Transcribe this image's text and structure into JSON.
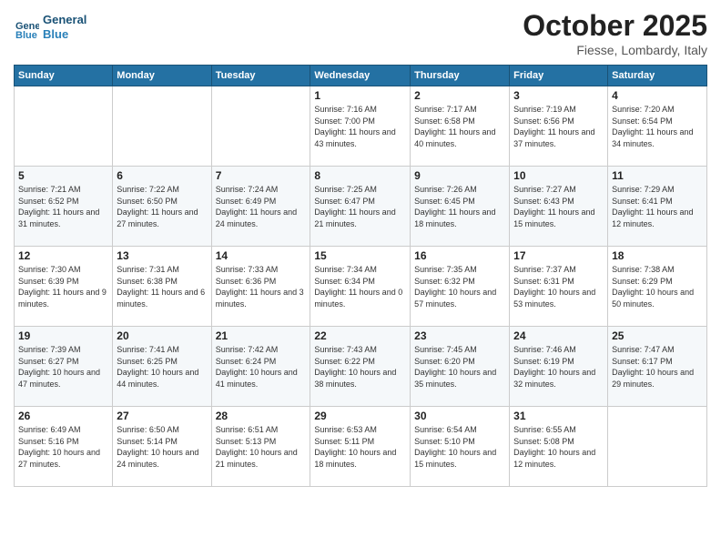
{
  "logo": {
    "line1": "General",
    "line2": "Blue"
  },
  "header": {
    "month": "October 2025",
    "location": "Fiesse, Lombardy, Italy"
  },
  "days_of_week": [
    "Sunday",
    "Monday",
    "Tuesday",
    "Wednesday",
    "Thursday",
    "Friday",
    "Saturday"
  ],
  "weeks": [
    [
      {
        "day": "",
        "sunrise": "",
        "sunset": "",
        "daylight": ""
      },
      {
        "day": "",
        "sunrise": "",
        "sunset": "",
        "daylight": ""
      },
      {
        "day": "",
        "sunrise": "",
        "sunset": "",
        "daylight": ""
      },
      {
        "day": "1",
        "sunrise": "Sunrise: 7:16 AM",
        "sunset": "Sunset: 7:00 PM",
        "daylight": "Daylight: 11 hours and 43 minutes."
      },
      {
        "day": "2",
        "sunrise": "Sunrise: 7:17 AM",
        "sunset": "Sunset: 6:58 PM",
        "daylight": "Daylight: 11 hours and 40 minutes."
      },
      {
        "day": "3",
        "sunrise": "Sunrise: 7:19 AM",
        "sunset": "Sunset: 6:56 PM",
        "daylight": "Daylight: 11 hours and 37 minutes."
      },
      {
        "day": "4",
        "sunrise": "Sunrise: 7:20 AM",
        "sunset": "Sunset: 6:54 PM",
        "daylight": "Daylight: 11 hours and 34 minutes."
      }
    ],
    [
      {
        "day": "5",
        "sunrise": "Sunrise: 7:21 AM",
        "sunset": "Sunset: 6:52 PM",
        "daylight": "Daylight: 11 hours and 31 minutes."
      },
      {
        "day": "6",
        "sunrise": "Sunrise: 7:22 AM",
        "sunset": "Sunset: 6:50 PM",
        "daylight": "Daylight: 11 hours and 27 minutes."
      },
      {
        "day": "7",
        "sunrise": "Sunrise: 7:24 AM",
        "sunset": "Sunset: 6:49 PM",
        "daylight": "Daylight: 11 hours and 24 minutes."
      },
      {
        "day": "8",
        "sunrise": "Sunrise: 7:25 AM",
        "sunset": "Sunset: 6:47 PM",
        "daylight": "Daylight: 11 hours and 21 minutes."
      },
      {
        "day": "9",
        "sunrise": "Sunrise: 7:26 AM",
        "sunset": "Sunset: 6:45 PM",
        "daylight": "Daylight: 11 hours and 18 minutes."
      },
      {
        "day": "10",
        "sunrise": "Sunrise: 7:27 AM",
        "sunset": "Sunset: 6:43 PM",
        "daylight": "Daylight: 11 hours and 15 minutes."
      },
      {
        "day": "11",
        "sunrise": "Sunrise: 7:29 AM",
        "sunset": "Sunset: 6:41 PM",
        "daylight": "Daylight: 11 hours and 12 minutes."
      }
    ],
    [
      {
        "day": "12",
        "sunrise": "Sunrise: 7:30 AM",
        "sunset": "Sunset: 6:39 PM",
        "daylight": "Daylight: 11 hours and 9 minutes."
      },
      {
        "day": "13",
        "sunrise": "Sunrise: 7:31 AM",
        "sunset": "Sunset: 6:38 PM",
        "daylight": "Daylight: 11 hours and 6 minutes."
      },
      {
        "day": "14",
        "sunrise": "Sunrise: 7:33 AM",
        "sunset": "Sunset: 6:36 PM",
        "daylight": "Daylight: 11 hours and 3 minutes."
      },
      {
        "day": "15",
        "sunrise": "Sunrise: 7:34 AM",
        "sunset": "Sunset: 6:34 PM",
        "daylight": "Daylight: 11 hours and 0 minutes."
      },
      {
        "day": "16",
        "sunrise": "Sunrise: 7:35 AM",
        "sunset": "Sunset: 6:32 PM",
        "daylight": "Daylight: 10 hours and 57 minutes."
      },
      {
        "day": "17",
        "sunrise": "Sunrise: 7:37 AM",
        "sunset": "Sunset: 6:31 PM",
        "daylight": "Daylight: 10 hours and 53 minutes."
      },
      {
        "day": "18",
        "sunrise": "Sunrise: 7:38 AM",
        "sunset": "Sunset: 6:29 PM",
        "daylight": "Daylight: 10 hours and 50 minutes."
      }
    ],
    [
      {
        "day": "19",
        "sunrise": "Sunrise: 7:39 AM",
        "sunset": "Sunset: 6:27 PM",
        "daylight": "Daylight: 10 hours and 47 minutes."
      },
      {
        "day": "20",
        "sunrise": "Sunrise: 7:41 AM",
        "sunset": "Sunset: 6:25 PM",
        "daylight": "Daylight: 10 hours and 44 minutes."
      },
      {
        "day": "21",
        "sunrise": "Sunrise: 7:42 AM",
        "sunset": "Sunset: 6:24 PM",
        "daylight": "Daylight: 10 hours and 41 minutes."
      },
      {
        "day": "22",
        "sunrise": "Sunrise: 7:43 AM",
        "sunset": "Sunset: 6:22 PM",
        "daylight": "Daylight: 10 hours and 38 minutes."
      },
      {
        "day": "23",
        "sunrise": "Sunrise: 7:45 AM",
        "sunset": "Sunset: 6:20 PM",
        "daylight": "Daylight: 10 hours and 35 minutes."
      },
      {
        "day": "24",
        "sunrise": "Sunrise: 7:46 AM",
        "sunset": "Sunset: 6:19 PM",
        "daylight": "Daylight: 10 hours and 32 minutes."
      },
      {
        "day": "25",
        "sunrise": "Sunrise: 7:47 AM",
        "sunset": "Sunset: 6:17 PM",
        "daylight": "Daylight: 10 hours and 29 minutes."
      }
    ],
    [
      {
        "day": "26",
        "sunrise": "Sunrise: 6:49 AM",
        "sunset": "Sunset: 5:16 PM",
        "daylight": "Daylight: 10 hours and 27 minutes."
      },
      {
        "day": "27",
        "sunrise": "Sunrise: 6:50 AM",
        "sunset": "Sunset: 5:14 PM",
        "daylight": "Daylight: 10 hours and 24 minutes."
      },
      {
        "day": "28",
        "sunrise": "Sunrise: 6:51 AM",
        "sunset": "Sunset: 5:13 PM",
        "daylight": "Daylight: 10 hours and 21 minutes."
      },
      {
        "day": "29",
        "sunrise": "Sunrise: 6:53 AM",
        "sunset": "Sunset: 5:11 PM",
        "daylight": "Daylight: 10 hours and 18 minutes."
      },
      {
        "day": "30",
        "sunrise": "Sunrise: 6:54 AM",
        "sunset": "Sunset: 5:10 PM",
        "daylight": "Daylight: 10 hours and 15 minutes."
      },
      {
        "day": "31",
        "sunrise": "Sunrise: 6:55 AM",
        "sunset": "Sunset: 5:08 PM",
        "daylight": "Daylight: 10 hours and 12 minutes."
      },
      {
        "day": "",
        "sunrise": "",
        "sunset": "",
        "daylight": ""
      }
    ]
  ]
}
